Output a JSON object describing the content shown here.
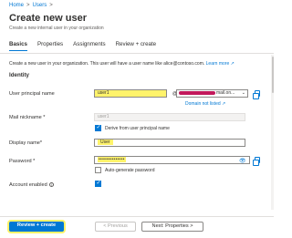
{
  "breadcrumb": {
    "home": "Home",
    "sep1": ">",
    "users": "Users",
    "sep2": ">"
  },
  "page": {
    "title": "Create new user",
    "subtitle": "Create a new internal user in your organization"
  },
  "tabs": [
    {
      "label": "Basics",
      "active": true
    },
    {
      "label": "Properties",
      "active": false
    },
    {
      "label": "Assignments",
      "active": false
    },
    {
      "label": "Review + create",
      "active": false
    }
  ],
  "description": {
    "text": "Create a new user in your organization. This user will have a user name like alice@contoso.com.",
    "learn_more": "Learn more ↗"
  },
  "identity": {
    "heading": "Identity",
    "upn_label": "User principal name",
    "upn_value": "user1",
    "at": "@",
    "domain_suffix": "mail.on...",
    "domain_chevron": "⌄",
    "domain_not_listed": "Domain not listed ↗",
    "mail_nickname_label": "Mail nickname *",
    "mail_nickname_value": "user1",
    "derive_label": "Derive from user principal name",
    "derive_checked": true,
    "display_name_label": "Display name*",
    "display_name_value": "User",
    "password_label": "Password *",
    "password_value": "••••••••••••••",
    "eye_glyph": "👁",
    "autogen_label": "Auto-generate password",
    "autogen_checked": false,
    "account_enabled_label": "Account enabled",
    "info_glyph": "i",
    "account_enabled_checked": true
  },
  "footer": {
    "review_create": "Review + create",
    "previous": "< Previous",
    "next": "Next: Properties >"
  },
  "colors": {
    "accent": "#0078d4",
    "highlight": "#fff36b",
    "redaction": "#c2185b"
  }
}
